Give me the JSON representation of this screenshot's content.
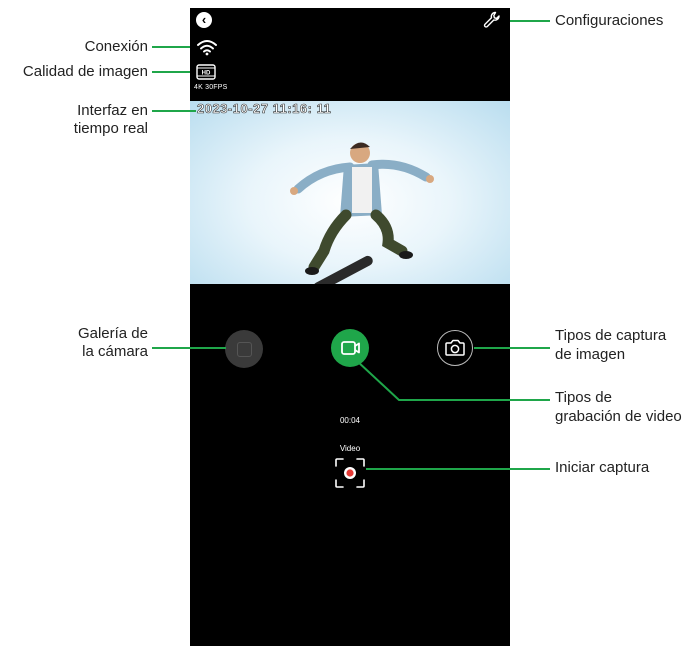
{
  "annotations": {
    "configuraciones": "Configuraciones",
    "conexion": "Conexión",
    "calidad": "Calidad de imagen",
    "interfaz_line1": "Interfaz en",
    "interfaz_line2": "tiempo real",
    "galeria_line1": "Galería de",
    "galeria_line2": "la cámara",
    "tipos_captura_line1": "Tipos de captura",
    "tipos_captura_line2": "de imagen",
    "tipos_grabacion_line1": "Tipos de",
    "tipos_grabacion_line2": "grabación de video",
    "iniciar": "Iniciar captura"
  },
  "screen": {
    "resolution": "4K 30FPS",
    "hd_badge": "HD",
    "timestamp": "2023-10-27  11:16: 11",
    "timer": "00:04",
    "mode": "Video"
  },
  "icons": {
    "back": "chevron-left-icon",
    "settings": "wrench-icon",
    "connection": "wifi-icon",
    "quality": "hd-film-icon",
    "gallery": "gallery-icon",
    "video": "video-camera-icon",
    "photo": "camera-icon",
    "capture": "record-icon"
  },
  "colors": {
    "accent": "#1fa64a",
    "screen_bg": "#000000",
    "record": "#e53935"
  }
}
